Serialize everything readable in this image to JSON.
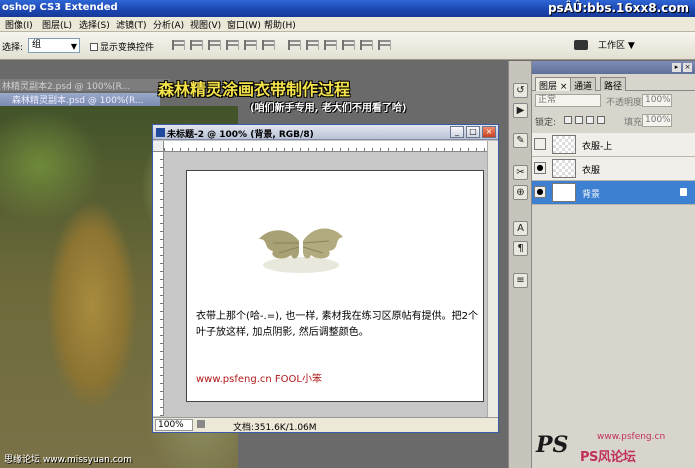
{
  "app": {
    "title": "oshop CS3 Extended",
    "watermark": "psÂÛ̈:bbs.16xx8.com"
  },
  "menu": [
    "图像(I)",
    "图层(L)",
    "选择(S)",
    "滤镜(T)",
    "分析(A)",
    "视图(V)",
    "窗口(W)",
    "帮助(H)"
  ],
  "options": {
    "select_label": "选择:",
    "select_value": "组",
    "show_transform": "显示变换控件",
    "workspace_label": "工作区 ▼"
  },
  "background_docs": {
    "title1": "林精灵副本2.psd @ 100%(R...",
    "title2": "森林精灵副本.psd @ 100%(R..."
  },
  "overlay": {
    "title": "森林精灵涂画衣带制作过程",
    "subtitle": "(咱们新手专用, 老大们不用看了哈)"
  },
  "document": {
    "title": "未标题-2 @ 100% (背景, RGB/8)",
    "body_text": "衣带上那个(哈-.=), 也一样, 素材我在练习区原帖有提供。把2个叶子放这样, 加点阴影, 然后调整颜色。",
    "url_text": "www.psfeng.cn   FOOL小笨",
    "zoom": "100%",
    "doc_info": "文档:351.6K/1.06M"
  },
  "layers_panel": {
    "tabs": [
      "图层 ×",
      "通道",
      "路径"
    ],
    "blend_mode": "正常",
    "opacity_label": "不透明度:",
    "opacity_value": "100%",
    "lock_label": "锁定:",
    "fill_label": "填充:",
    "fill_value": "100%",
    "layers": [
      {
        "name": "衣服-上",
        "visible": false,
        "selected": false
      },
      {
        "name": "衣服",
        "visible": true,
        "selected": false
      },
      {
        "name": "背景",
        "visible": true,
        "selected": true
      }
    ]
  },
  "footer": {
    "left_credit": "思缘论坛 www.missyuan.com",
    "logo_ps": "PS",
    "logo_site": "www.psfeng.cn",
    "logo_name": "PS风论坛"
  },
  "colors": {
    "selected_layer": "#3d7fd1",
    "title_accent": "#f4e24a",
    "url_red": "#b01818"
  }
}
